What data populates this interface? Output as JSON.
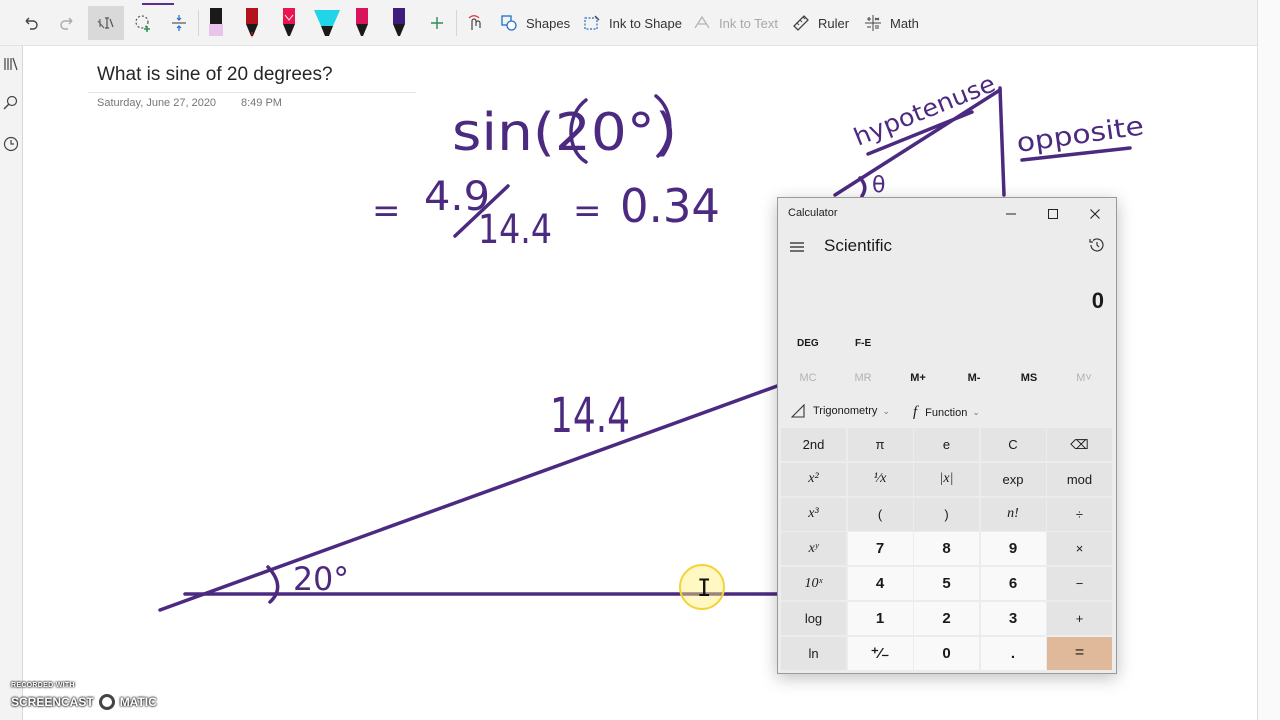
{
  "toolbar": {
    "items": [
      {
        "name": "undo-button",
        "icon": "undo-icon"
      },
      {
        "name": "redo-button",
        "icon": "redo-icon"
      },
      {
        "name": "type-button",
        "icon": "text-select-icon"
      },
      {
        "name": "lasso-button",
        "icon": "lasso-select-icon"
      },
      {
        "name": "space-button",
        "icon": "add-space-icon"
      }
    ],
    "pen_colors": [
      "#e8c4ec",
      "#b5121b",
      "#e8154f",
      "#22d4e8",
      "#d8155a",
      "#3e1d7d"
    ],
    "shapes_label": "Shapes",
    "ink_to_shape_label": "Ink to Shape",
    "ink_to_text_label": "Ink to Text",
    "ruler_label": "Ruler",
    "math_label": "Math"
  },
  "page": {
    "title": "What is sine of 20 degrees?",
    "date": "Saturday, June 27, 2020",
    "time": "8:49 PM"
  },
  "ink": {
    "color": "#4b2a80",
    "eq_line1": "sin(20°)",
    "eq_numerator": "4.9",
    "eq_denominator": "14.4",
    "eq_result": "0.34",
    "eq_equals": "=",
    "triangle_hyp": "14.4",
    "triangle_angle": "20°",
    "small_hyp": "hypotenuse",
    "small_opp": "opposite",
    "small_angle": "θ"
  },
  "calculator": {
    "title": "Calculator",
    "mode": "Scientific",
    "display": "0",
    "angle_unit": "DEG",
    "fe": "F-E",
    "memory": [
      "MC",
      "MR",
      "M+",
      "M-",
      "MS",
      "M˅"
    ],
    "trig_label": "Trigonometry",
    "func_label": "Function",
    "keys": [
      [
        "2nd",
        "π",
        "e",
        "C",
        "⌫"
      ],
      [
        "x²",
        "¹⁄x",
        "|x|",
        "exp",
        "mod"
      ],
      [
        "x³",
        "(",
        ")",
        "n!",
        "÷"
      ],
      [
        "xʸ",
        "7",
        "8",
        "9",
        "×"
      ],
      [
        "10ˣ",
        "4",
        "5",
        "6",
        "−"
      ],
      [
        "log",
        "1",
        "2",
        "3",
        "+"
      ],
      [
        "ln",
        "⁺⁄₋",
        "0",
        ".",
        "="
      ]
    ],
    "accent": "#e0b89a"
  },
  "watermark": {
    "top": "RECORDED WITH",
    "left": "SCREENCAST",
    "right": "MATIC"
  }
}
